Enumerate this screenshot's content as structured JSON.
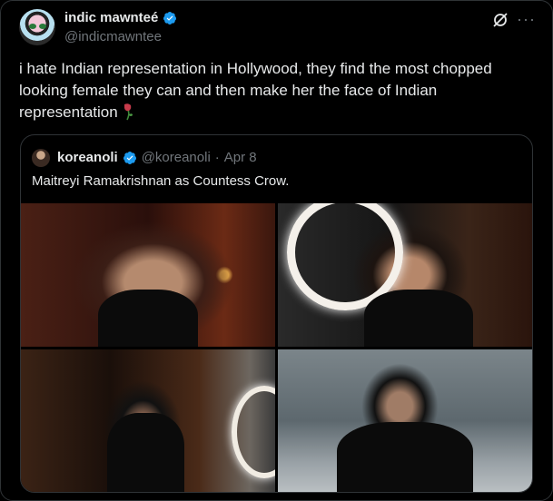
{
  "tweet": {
    "author_name": "indic mawnteé",
    "author_handle": "@indicmawntee",
    "text": "i hate Indian representation in Hollywood, they find the most chopped looking female they can and then make her the face of Indian representation",
    "emoji": "wilted-rose"
  },
  "quoted": {
    "author_name": "koreanoli",
    "author_handle": "@koreanoli",
    "separator": "·",
    "date": "Apr 8",
    "text": "Maitreyi Ramakrishnan as Countess Crow.",
    "media_count": 4
  },
  "colors": {
    "verified": "#1d9bf0",
    "muted": "#71767b",
    "text": "#e7e9ea",
    "border": "#2f3336"
  },
  "icons": [
    "verified-badge-icon",
    "grok-icon",
    "more-icon",
    "wilted-rose-icon"
  ]
}
